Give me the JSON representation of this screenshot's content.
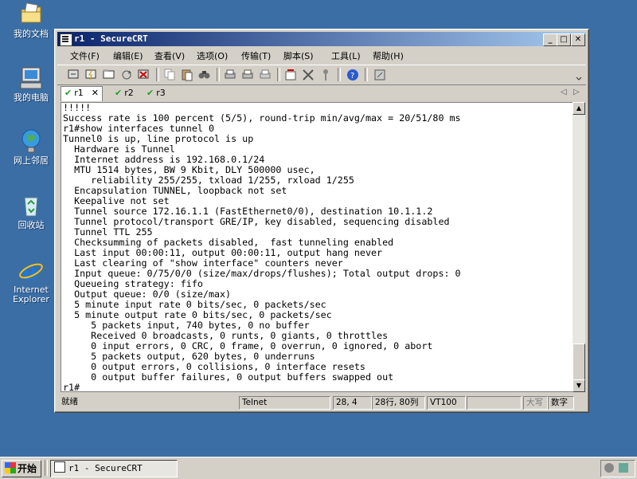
{
  "desktop": {
    "icons": [
      {
        "label": "我的文档",
        "icon": "my-documents-icon"
      },
      {
        "label": "我的电脑",
        "icon": "my-computer-icon"
      },
      {
        "label": "网上邻居",
        "icon": "network-places-icon"
      },
      {
        "label": "回收站",
        "icon": "recycle-bin-icon"
      },
      {
        "label": "Internet Explorer",
        "icon": "ie-icon"
      }
    ]
  },
  "window": {
    "title": "r1 - SecureCRT",
    "menu": [
      "文件(F)",
      "编辑(E)",
      "查看(V)",
      "选项(O)",
      "传输(T)",
      "脚本(S)",
      "工具(L)",
      "帮助(H)"
    ],
    "tabs": [
      {
        "label": "r1",
        "active": true
      },
      {
        "label": "r2",
        "active": false
      },
      {
        "label": "r3",
        "active": false
      }
    ],
    "terminal_lines": [
      "!!!!!",
      "Success rate is 100 percent (5/5), round-trip min/avg/max = 20/51/80 ms",
      "r1#show interfaces tunnel 0",
      "Tunnel0 is up, line protocol is up",
      "  Hardware is Tunnel",
      "  Internet address is 192.168.0.1/24",
      "  MTU 1514 bytes, BW 9 Kbit, DLY 500000 usec,",
      "     reliability 255/255, txload 1/255, rxload 1/255",
      "  Encapsulation TUNNEL, loopback not set",
      "  Keepalive not set",
      "  Tunnel source 172.16.1.1 (FastEthernet0/0), destination 10.1.1.2",
      "  Tunnel protocol/transport GRE/IP, key disabled, sequencing disabled",
      "  Tunnel TTL 255",
      "  Checksumming of packets disabled,  fast tunneling enabled",
      "  Last input 00:00:11, output 00:00:11, output hang never",
      "  Last clearing of \"show interface\" counters never",
      "  Input queue: 0/75/0/0 (size/max/drops/flushes); Total output drops: 0",
      "  Queueing strategy: fifo",
      "  Output queue: 0/0 (size/max)",
      "  5 minute input rate 0 bits/sec, 0 packets/sec",
      "  5 minute output rate 0 bits/sec, 0 packets/sec",
      "     5 packets input, 740 bytes, 0 no buffer",
      "     Received 0 broadcasts, 0 runts, 0 giants, 0 throttles",
      "     0 input errors, 0 CRC, 0 frame, 0 overrun, 0 ignored, 0 abort",
      "     5 packets output, 620 bytes, 0 underruns",
      "     0 output errors, 0 collisions, 0 interface resets",
      "     0 output buffer failures, 0 output buffers swapped out",
      "r1#"
    ],
    "status": {
      "ready": "就绪",
      "protocol": "Telnet",
      "cursor": "28,  4",
      "size": "28行, 80列",
      "emulation": "VT100",
      "caps": "大写",
      "num": "数字"
    }
  },
  "taskbar": {
    "start_label": "开始",
    "task_label": "r1 - SecureCRT"
  }
}
